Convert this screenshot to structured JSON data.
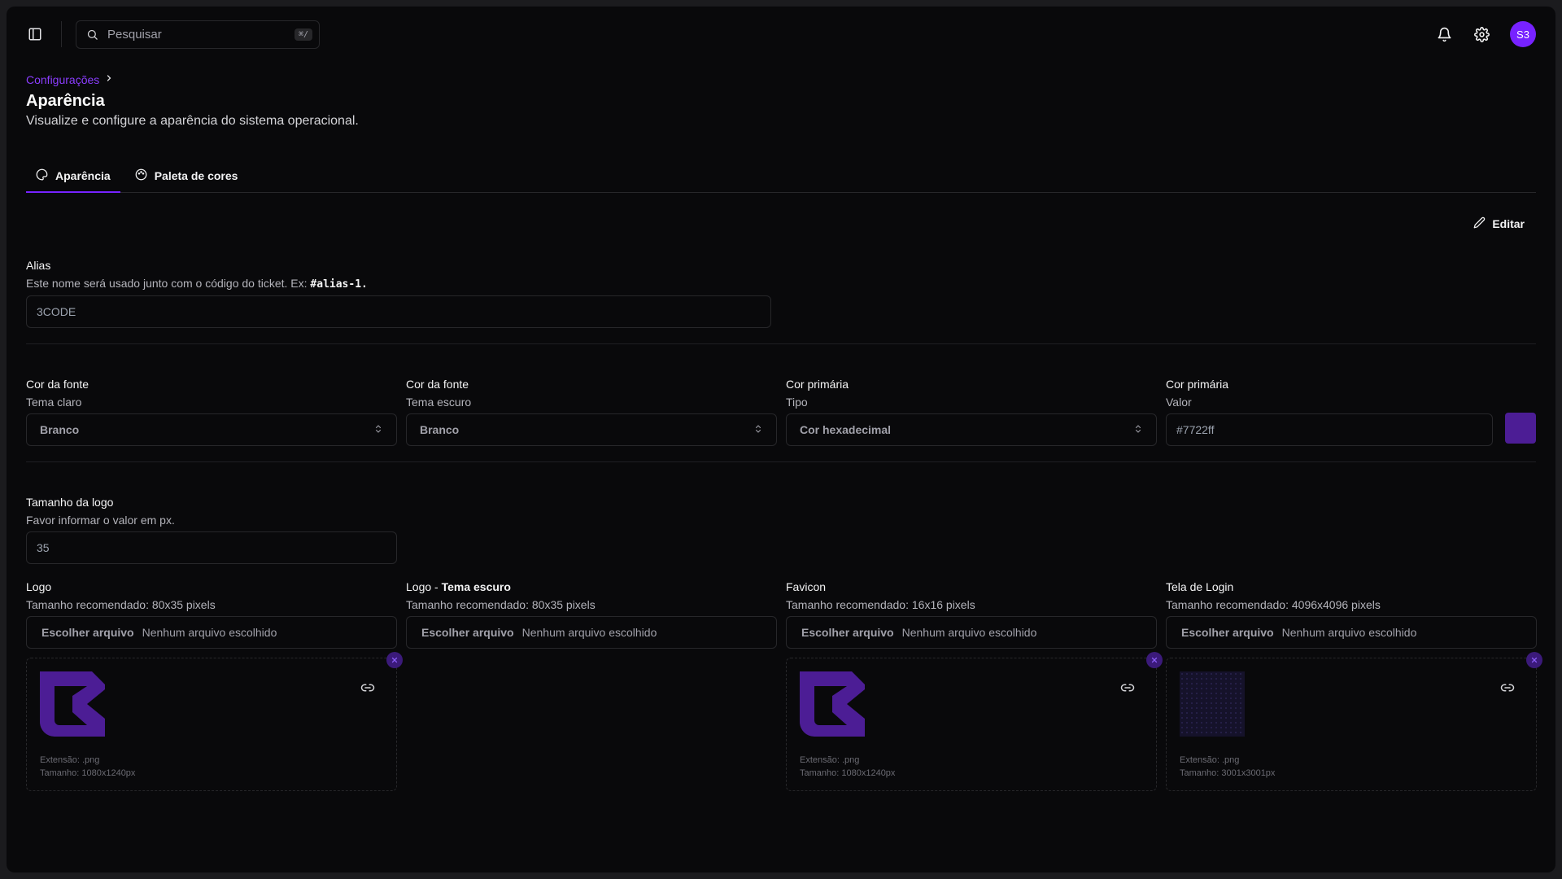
{
  "search": {
    "placeholder": "Pesquisar",
    "shortcut": "⌘/"
  },
  "user": {
    "initials": "S3"
  },
  "breadcrumb": {
    "parent": "Configurações"
  },
  "page": {
    "title": "Aparência",
    "subtitle": "Visualize e configure a aparência do sistema operacional."
  },
  "tabs": [
    {
      "label": "Aparência",
      "active": true
    },
    {
      "label": "Paleta de cores",
      "active": false
    }
  ],
  "edit_label": "Editar",
  "alias": {
    "label": "Alias",
    "hint_prefix": "Este nome será usado junto com o código do ticket. Ex: ",
    "hint_code": "#alias-1.",
    "value": "3CODE"
  },
  "colors": [
    {
      "label": "Cor da fonte",
      "hint": "Tema claro",
      "value": "Branco"
    },
    {
      "label": "Cor da fonte",
      "hint": "Tema escuro",
      "value": "Branco"
    },
    {
      "label": "Cor primária",
      "hint": "Tipo",
      "value": "Cor hexadecimal"
    },
    {
      "label": "Cor primária",
      "hint": "Valor",
      "value": "#7722ff"
    }
  ],
  "logo_size": {
    "label": "Tamanho da logo",
    "hint": "Favor informar o valor em px.",
    "value": "35"
  },
  "uploads": [
    {
      "label": "Logo",
      "label_bold": "",
      "hint": "Tamanho recomendado: 80x35 pixels",
      "choose": "Escolher arquivo",
      "none": "Nenhum arquivo escolhido",
      "ext": "Extensão: .png",
      "size": "Tamanho: 1080x1240px"
    },
    {
      "label": "Logo - ",
      "label_bold": "Tema escuro",
      "hint": "Tamanho recomendado: 80x35 pixels",
      "choose": "Escolher arquivo",
      "none": "Nenhum arquivo escolhido"
    },
    {
      "label": "Favicon",
      "label_bold": "",
      "hint": "Tamanho recomendado: 16x16 pixels",
      "choose": "Escolher arquivo",
      "none": "Nenhum arquivo escolhido",
      "ext": "Extensão: .png",
      "size": "Tamanho: 1080x1240px"
    },
    {
      "label": "Tela de Login",
      "label_bold": "",
      "hint": "Tamanho recomendado: 4096x4096 pixels",
      "choose": "Escolher arquivo",
      "none": "Nenhum arquivo escolhido",
      "ext": "Extensão: .png",
      "size": "Tamanho: 3001x3001px"
    }
  ],
  "theme": {
    "accent": "#7722ff",
    "swatch": "#4c1d95",
    "background": "#09090b"
  }
}
